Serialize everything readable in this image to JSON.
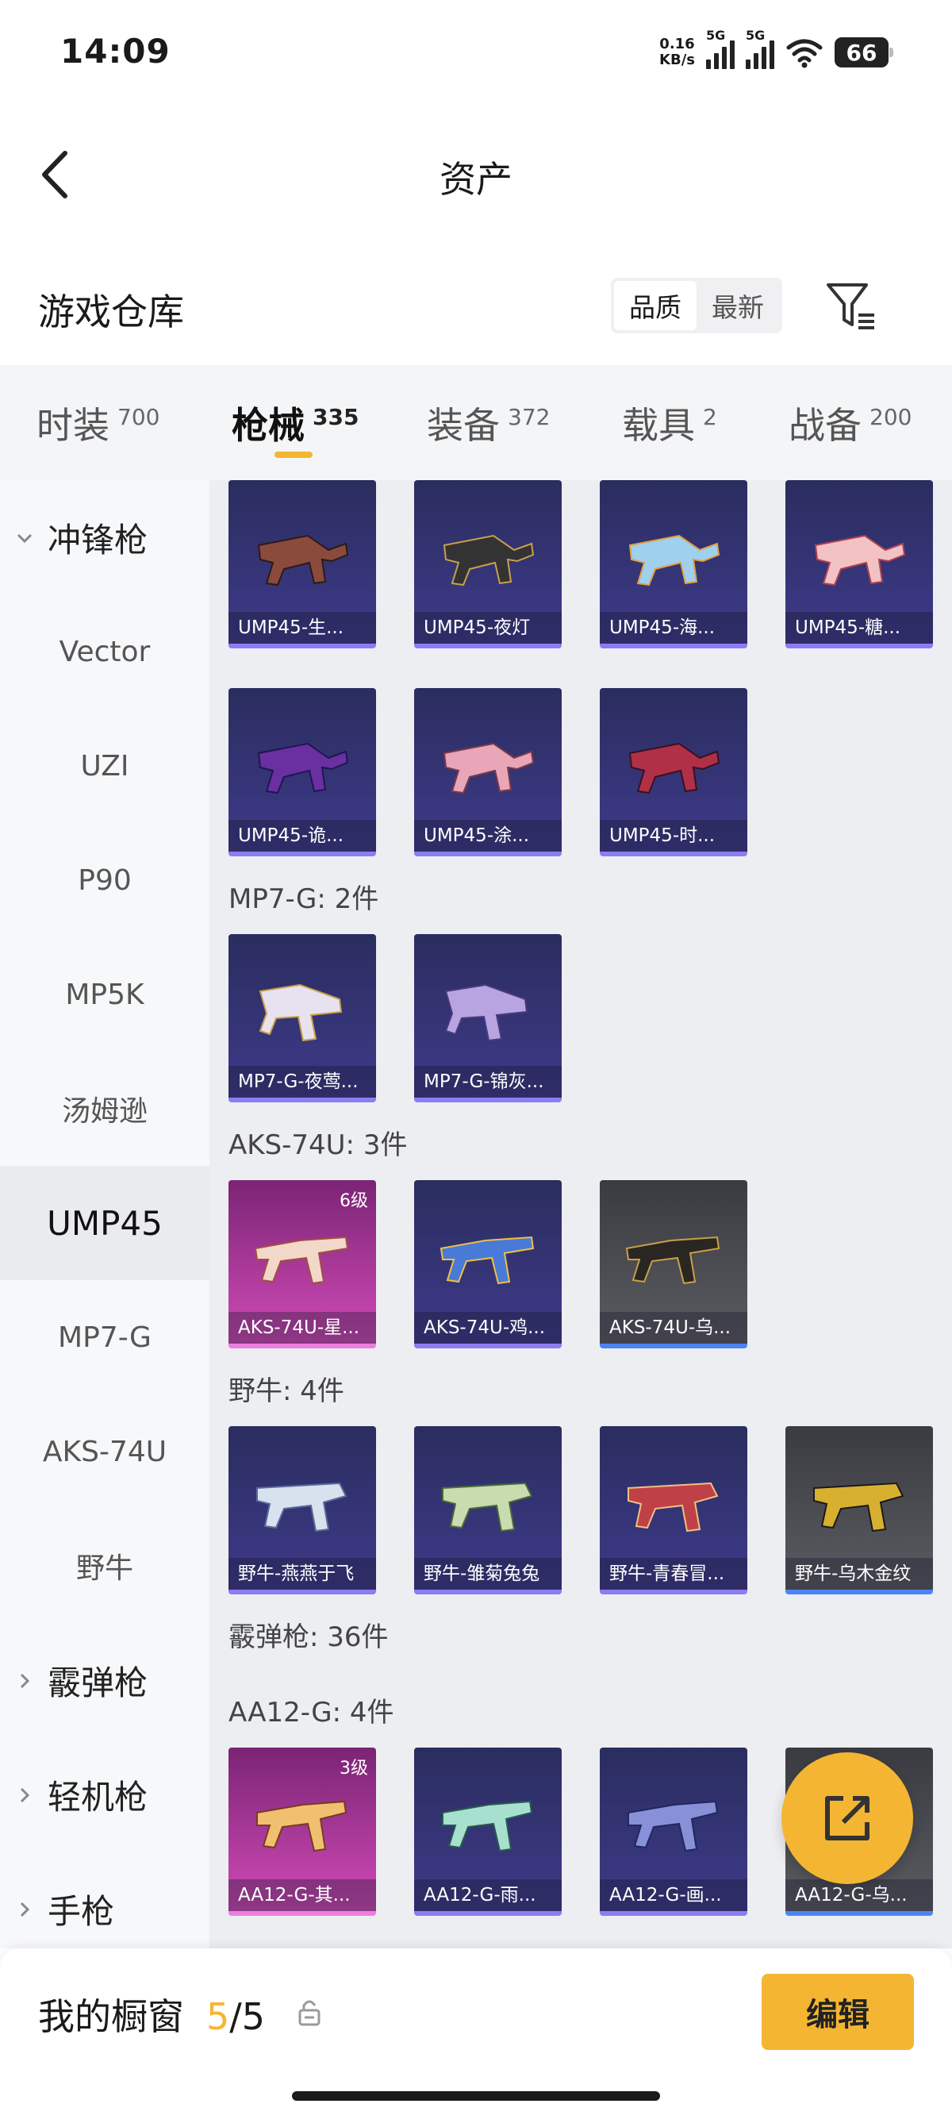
{
  "status_bar": {
    "time": "14:09",
    "net_speed_value": "0.16",
    "net_speed_unit": "KB/s",
    "signal_1": "5G",
    "signal_2": "5G",
    "battery": "66"
  },
  "nav": {
    "title": "资产"
  },
  "section": {
    "title": "游戏仓库",
    "sort_options": [
      "品质",
      "最新"
    ],
    "sort_selected": "品质"
  },
  "tabs": [
    {
      "label": "时装",
      "count": "700"
    },
    {
      "label": "枪械",
      "count": "335",
      "active": true
    },
    {
      "label": "装备",
      "count": "372"
    },
    {
      "label": "载具",
      "count": "2"
    },
    {
      "label": "战备",
      "count": "200"
    }
  ],
  "sidebar": {
    "groups": [
      {
        "label": "冲锋枪",
        "expanded": true
      },
      {
        "label": "霰弹枪",
        "expanded": false
      },
      {
        "label": "轻机枪",
        "expanded": false
      },
      {
        "label": "手枪",
        "expanded": false
      }
    ],
    "items": [
      "Vector",
      "UZI",
      "P90",
      "MP5K",
      "汤姆逊",
      "UMP45",
      "MP7-G",
      "AKS-74U",
      "野牛"
    ],
    "active_item": "UMP45"
  },
  "grid": {
    "ump45_cards": [
      {
        "name": "UMP45-生...",
        "rarity": "purple"
      },
      {
        "name": "UMP45-夜灯",
        "rarity": "purple"
      },
      {
        "name": "UMP45-海...",
        "rarity": "purple"
      },
      {
        "name": "UMP45-糖...",
        "rarity": "purple"
      },
      {
        "name": "UMP45-诡...",
        "rarity": "purple"
      },
      {
        "name": "UMP45-涂...",
        "rarity": "purple"
      },
      {
        "name": "UMP45-时...",
        "rarity": "purple"
      }
    ],
    "mp7_label": "MP7-G: 2件",
    "mp7_cards": [
      {
        "name": "MP7-G-夜莺...",
        "rarity": "purple"
      },
      {
        "name": "MP7-G-锦灰...",
        "rarity": "purple"
      }
    ],
    "aks_label": "AKS-74U: 3件",
    "aks_cards": [
      {
        "name": "AKS-74U-星...",
        "rarity": "pink",
        "level": "6级"
      },
      {
        "name": "AKS-74U-鸡...",
        "rarity": "purple"
      },
      {
        "name": "AKS-74U-乌...",
        "rarity": "gray"
      }
    ],
    "bison_label": "野牛: 4件",
    "bison_cards": [
      {
        "name": "野牛-燕燕于飞",
        "rarity": "purple"
      },
      {
        "name": "野牛-雏菊兔兔",
        "rarity": "purple"
      },
      {
        "name": "野牛-青春冒...",
        "rarity": "purple"
      },
      {
        "name": "野牛-乌木金纹",
        "rarity": "gray"
      }
    ],
    "shotgun_label": "霰弹枪: 36件",
    "aa12_label": "AA12-G: 4件",
    "aa12_cards": [
      {
        "name": "AA12-G-其...",
        "rarity": "pink",
        "level": "3级"
      },
      {
        "name": "AA12-G-雨...",
        "rarity": "purple"
      },
      {
        "name": "AA12-G-画...",
        "rarity": "purple"
      },
      {
        "name": "AA12-G-乌...",
        "rarity": "gray"
      }
    ]
  },
  "bottom": {
    "label": "我的橱窗",
    "count_current": "5",
    "count_sep": "/",
    "count_total": "5",
    "edit_label": "编辑"
  },
  "colors": {
    "accent": "#f4b632",
    "rarity_purple": "#8a7df2",
    "rarity_pink": "#ec7ee0",
    "rarity_gray": "#4c84f5"
  },
  "icons": [
    "back-icon",
    "filter-icon",
    "chevron-down-icon",
    "chevron-right-icon",
    "share-icon",
    "lock-icon",
    "gun-icon"
  ]
}
